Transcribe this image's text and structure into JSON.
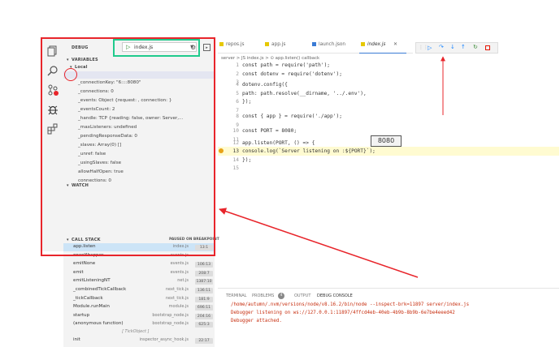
{
  "debug_toolbar": {
    "label": "DEBUG",
    "config_value": "index.js"
  },
  "variables": {
    "header": "VARIABLES",
    "scope": "Local",
    "items": [
      "_connectionKey: \"6::::8080\"",
      "_connections: 0",
      "_events: Object {request: , connection: }",
      "_eventsCount: 2",
      "_handle: TCP {reading: false, owner: Server,...",
      "_maxListeners: undefined",
      "_pendingResponseData: 0",
      "_slaves: Array(0) []",
      "_unref: false",
      "_usingSlaves: false",
      "allowHalfOpen: true",
      "connections: 0"
    ]
  },
  "watch": {
    "header": "WATCH"
  },
  "call_stack": {
    "header": "CALL STACK",
    "status": "PAUSED ON BREAKPOINT",
    "frames": [
      {
        "fn": "app.listen",
        "file": "index.js",
        "line": "13:1"
      },
      {
        "fn": "onceWrapper",
        "file": "events.js",
        "line": ""
      },
      {
        "fn": "emitNone",
        "file": "events.js",
        "line": "106:13"
      },
      {
        "fn": "emit",
        "file": "events.js",
        "line": "208:7"
      },
      {
        "fn": "emitListeningNT",
        "file": "net.js",
        "line": "1387:10"
      },
      {
        "fn": "_combinedTickCallback",
        "file": "next_tick.js",
        "line": "136:11"
      },
      {
        "fn": "_tickCallback",
        "file": "next_tick.js",
        "line": "181:9"
      },
      {
        "fn": "Module.runMain",
        "file": "module.js",
        "line": "696:11"
      },
      {
        "fn": "startup",
        "file": "bootstrap_node.js",
        "line": "204:16"
      },
      {
        "fn": "(anonymous function)",
        "file": "bootstrap_node.js",
        "line": "625:3"
      }
    ],
    "async_label": "[ TickObject ]",
    "async_frames": [
      {
        "fn": "init",
        "file": "inspector_async_hook.js",
        "line": "22:17"
      }
    ]
  },
  "tabs": [
    "repos.js",
    "app.js",
    "launch.json",
    "index.js"
  ],
  "breadcrumb": "server > JS index.js > ⊙ app.listen() callback",
  "code": [
    {
      "n": "1",
      "text": "const path = require('path');"
    },
    {
      "n": "2",
      "text": "const dotenv = require('dotenv');"
    },
    {
      "n": "3",
      "text": ""
    },
    {
      "n": "4",
      "text": "dotenv.config({"
    },
    {
      "n": "5",
      "text": "  path: path.resolve(__dirname, '../.env'),"
    },
    {
      "n": "6",
      "text": "});"
    },
    {
      "n": "7",
      "text": ""
    },
    {
      "n": "8",
      "text": "const { app } = require('./app');"
    },
    {
      "n": "9",
      "text": ""
    },
    {
      "n": "10",
      "text": "const PORT = 8080;"
    },
    {
      "n": "11",
      "text": ""
    },
    {
      "n": "12",
      "text": "app.listen(PORT, () => {"
    },
    {
      "n": "13",
      "text": "  console.log(`Server listening on :${PORT}`);"
    },
    {
      "n": "14",
      "text": "});"
    },
    {
      "n": "15",
      "text": ""
    }
  ],
  "hover_value": "8080",
  "panel": {
    "tabs": [
      "TERMINAL",
      "PROBLEMS",
      "OUTPUT",
      "DEBUG CONSOLE"
    ],
    "problems_count": "4",
    "lines": [
      "/home/autumn/.nvm/versions/node/v8.16.2/bin/node --inspect-brk=11897 server/index.js",
      "Debugger listening on ws://127.0.0.1:11897/4ffcd4eb-40eb-4b9b-8b9b-6e7be4eeed42",
      "Debugger attached."
    ]
  },
  "colors": {
    "annotation_red": "#e8252b",
    "annotation_green": "#1fca8c",
    "breakpoint_line": "#fffbd1"
  }
}
